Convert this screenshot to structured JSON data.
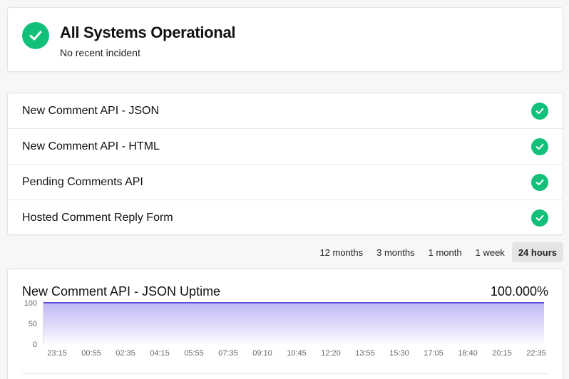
{
  "status": {
    "title": "All Systems Operational",
    "subtitle": "No recent incident",
    "color": "#12c07a"
  },
  "components": [
    {
      "name": "New Comment API - JSON",
      "status_icon": "check-circle-icon"
    },
    {
      "name": "New Comment API - HTML",
      "status_icon": "check-circle-icon"
    },
    {
      "name": "Pending Comments API",
      "status_icon": "check-circle-icon"
    },
    {
      "name": "Hosted Comment Reply Form",
      "status_icon": "check-circle-icon"
    }
  ],
  "range_tabs": [
    {
      "label": "12 months",
      "active": false
    },
    {
      "label": "3 months",
      "active": false
    },
    {
      "label": "1 month",
      "active": false
    },
    {
      "label": "1 week",
      "active": false
    },
    {
      "label": "24 hours",
      "active": true
    }
  ],
  "uptime": {
    "title": "New Comment API - JSON Uptime",
    "value": "100.000%"
  },
  "chart_data": {
    "type": "area",
    "y_ticks": [
      "100",
      "50",
      "0"
    ],
    "ylim": [
      0,
      100
    ],
    "x": [
      "23:15",
      "00:55",
      "02:35",
      "04:15",
      "05:55",
      "07:35",
      "09:10",
      "10:45",
      "12:20",
      "13:55",
      "15:30",
      "17:05",
      "18:40",
      "20:15",
      "22:35"
    ],
    "values": [
      100,
      100,
      100,
      100,
      100,
      100,
      100,
      100,
      100,
      100,
      100,
      100,
      100,
      100,
      100
    ],
    "line_color": "#5b4fd9",
    "fill_color": "#a89ff0",
    "grid": false,
    "title": "",
    "xlabel": "",
    "ylabel": ""
  }
}
